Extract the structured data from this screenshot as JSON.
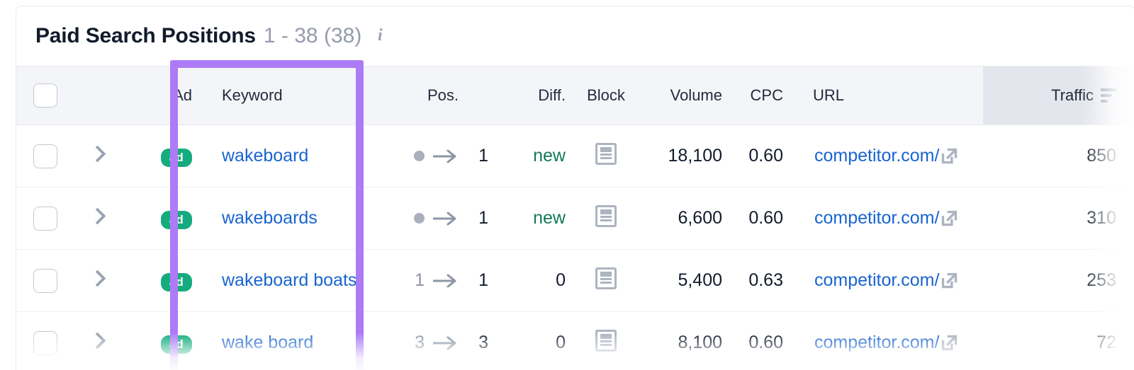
{
  "panel": {
    "title": "Paid Search Positions",
    "range": "1 - 38 (38)",
    "info_icon": "info-icon"
  },
  "table": {
    "columns": [
      {
        "key": "checkbox",
        "label": ""
      },
      {
        "key": "expand",
        "label": ""
      },
      {
        "key": "ad",
        "label": "Ad"
      },
      {
        "key": "keyword",
        "label": "Keyword"
      },
      {
        "key": "pos",
        "label": "Pos."
      },
      {
        "key": "diff",
        "label": "Diff."
      },
      {
        "key": "block",
        "label": "Block"
      },
      {
        "key": "volume",
        "label": "Volume"
      },
      {
        "key": "cpc",
        "label": "CPC"
      },
      {
        "key": "url",
        "label": "URL"
      },
      {
        "key": "traffic",
        "label": "Traffic"
      }
    ],
    "sorted_column": "Traffic",
    "sort_icon": "sort-descending-icon",
    "ad_badge_label": "ad",
    "rows": [
      {
        "ad": "ad",
        "keyword": "wakeboard",
        "pos_prev": "",
        "pos_prev_is_dot": true,
        "pos_arrow": "→",
        "pos_current": "1",
        "diff": "new",
        "diff_kind": "new",
        "block": "block-icon",
        "volume": "18,100",
        "cpc": "0.60",
        "url": "competitor.com/",
        "traffic": "850"
      },
      {
        "ad": "ad",
        "keyword": "wakeboards",
        "pos_prev": "",
        "pos_prev_is_dot": true,
        "pos_arrow": "→",
        "pos_current": "1",
        "diff": "new",
        "diff_kind": "new",
        "block": "block-icon",
        "volume": "6,600",
        "cpc": "0.60",
        "url": "competitor.com/",
        "traffic": "310"
      },
      {
        "ad": "ad",
        "keyword": "wakeboard boats",
        "pos_prev": "1",
        "pos_prev_is_dot": false,
        "pos_arrow": "→",
        "pos_current": "1",
        "diff": "0",
        "diff_kind": "zero",
        "block": "block-icon",
        "volume": "5,400",
        "cpc": "0.63",
        "url": "competitor.com/",
        "traffic": "253"
      },
      {
        "ad": "ad",
        "keyword": "wake board",
        "pos_prev": "3",
        "pos_prev_is_dot": false,
        "pos_arrow": "→",
        "pos_current": "3",
        "diff": "0",
        "diff_kind": "zero",
        "block": "block-icon",
        "volume": "8,100",
        "cpc": "0.60",
        "url": "competitor.com/",
        "traffic": "72"
      }
    ]
  },
  "highlight": {
    "name": "keyword-column-highlight",
    "color": "#ad7bf5"
  },
  "colors": {
    "link": "#1964cf",
    "badge_green": "#16ab7e",
    "diff_new_green": "#147a58",
    "header_bg": "#f4f5f9",
    "sorted_header_bg": "#e4e6ed",
    "muted_text": "#949cad"
  }
}
